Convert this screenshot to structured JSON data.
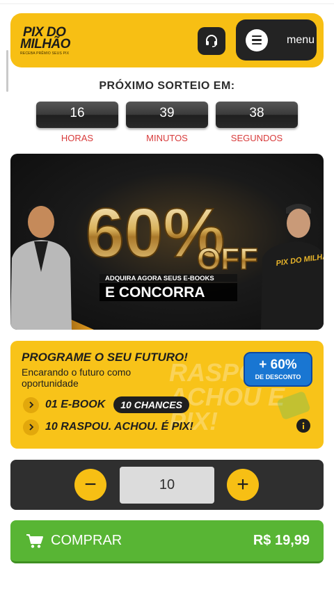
{
  "header": {
    "logo_line1": "PIX DO",
    "logo_line2": "MILHÃO",
    "logo_sub": "RECEBA PRÊMIO SEUS PIX",
    "support_icon": "headset-icon",
    "menu_icon": "hamburger-icon",
    "menu_label": "menu"
  },
  "countdown": {
    "title": "PRÓXIMO SORTEIO EM:",
    "hours": "16",
    "minutes": "39",
    "seconds": "38",
    "hours_label": "HORAS",
    "minutes_label": "MINUTOS",
    "seconds_label": "SEGUNDOS",
    "label_color": "#d83b3b"
  },
  "banner": {
    "percent": "60%",
    "off": "OFF",
    "line1": "ADQUIRA AGORA SEUS E-BOOKS",
    "line2": "E CONCORRA",
    "shirt_text": "PIX DO MILHÃO"
  },
  "promo": {
    "title": "PROGRAME O SEU FUTURO!",
    "subtitle": "Encarando o futuro como oportunidade",
    "discount_big": "+ 60%",
    "discount_small": "DE DESCONTO",
    "feature1": "01 E-BOOK",
    "feature1_pill": "10 CHANCES",
    "feature2": "10 RASPOU. ACHOU. É PIX!",
    "watermark": "RASPOU ACHOU É PIX!",
    "info_icon": "info-icon"
  },
  "quantity": {
    "minus": "−",
    "plus": "+",
    "value": "10"
  },
  "buy": {
    "label": "COMPRAR",
    "price": "R$ 19,99",
    "icon": "cart-icon"
  },
  "colors": {
    "brand_yellow": "#f7bf14",
    "dark": "#232323",
    "buy_green": "#58b534",
    "discount_blue": "#1976d2"
  }
}
